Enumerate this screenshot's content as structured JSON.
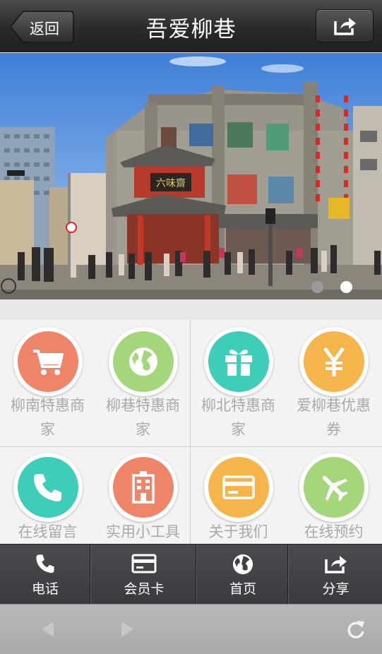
{
  "header": {
    "back_label": "返回",
    "title": "吾爱柳巷",
    "share_icon": "share-icon"
  },
  "banner": {
    "slide_count": 2,
    "active_slide": 2,
    "sign_text": "六味齋"
  },
  "grid": {
    "items": [
      {
        "label": "柳南特惠商家",
        "icon": "cart-icon",
        "color": "#ee8468"
      },
      {
        "label": "柳巷特惠商家",
        "icon": "globe-icon",
        "color": "#a6d67c"
      },
      {
        "label": "柳北特惠商家",
        "icon": "gift-icon",
        "color": "#3ecdb8"
      },
      {
        "label": "爱柳巷优惠券",
        "icon": "yen-icon",
        "color": "#f5b54c"
      },
      {
        "label": "在线留言",
        "icon": "phone-icon",
        "color": "#3ecdb8"
      },
      {
        "label": "实用小工具",
        "icon": "building-icon",
        "color": "#ee8468"
      },
      {
        "label": "关于我们",
        "icon": "card-icon",
        "color": "#f5b54c"
      },
      {
        "label": "在线预约",
        "icon": "plane-icon",
        "color": "#a6d67c"
      }
    ]
  },
  "bottom_nav": {
    "items": [
      {
        "label": "电话",
        "icon": "phone-icon"
      },
      {
        "label": "会员卡",
        "icon": "card-icon"
      },
      {
        "label": "首页",
        "icon": "globe-icon"
      },
      {
        "label": "分享",
        "icon": "share-icon"
      }
    ]
  },
  "browser_bar": {
    "back_icon": "browser-back-icon",
    "forward_icon": "browser-forward-icon",
    "refresh_icon": "refresh-icon"
  }
}
